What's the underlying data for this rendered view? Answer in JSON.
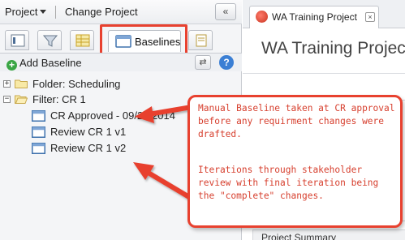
{
  "left_header": {
    "project_menu_label": "Project",
    "change_project_label": "Change Project",
    "collapse_label": "«"
  },
  "tabs": {
    "icon_tabs": [
      "list-icon",
      "filter-icon",
      "grid-icon",
      "baselines-icon",
      "document-icon"
    ],
    "active_label": "Baselines"
  },
  "toolbar": {
    "add_baseline_label": "Add Baseline",
    "help_label": "?"
  },
  "tree": {
    "folder_label": "Folder: Scheduling",
    "filter_label": "Filter: CR 1",
    "items": [
      "CR Approved - 09/29/2014",
      "Review CR 1 v1",
      "Review CR 1 v2"
    ]
  },
  "right": {
    "tab_label": "WA Training Project",
    "title": "WA Training Project",
    "summary_label": "Project Summary"
  },
  "callout": {
    "paragraph1": "Manual Baseline taken at CR approval before any requirment changes were drafted.",
    "paragraph2": "Iterations through stakeholder review with final iteration being the \"complete\" changes."
  },
  "colors": {
    "highlight_red": "#e8412f",
    "callout_text": "#d7402f",
    "accent_blue": "#3b7fd4",
    "add_green": "#3aa645"
  }
}
